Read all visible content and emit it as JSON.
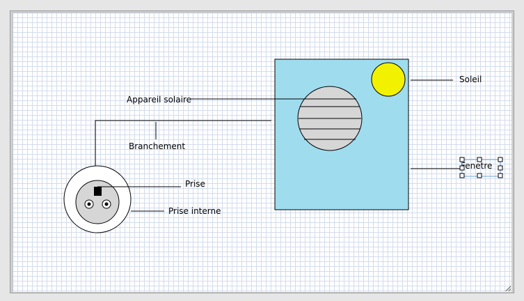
{
  "labels": {
    "appareil_solaire": "Appareil solaire",
    "branchement": "Branchement",
    "prise": "Prise",
    "prise_interne": "Prise interne",
    "soleil": "Soleil",
    "fenetre": "Fenetre"
  },
  "colors": {
    "window_fill": "#9fdcee",
    "sun_fill": "#f2f200",
    "panel_fill": "#d6d6d6",
    "selection_handle": "#2b6fd6"
  }
}
